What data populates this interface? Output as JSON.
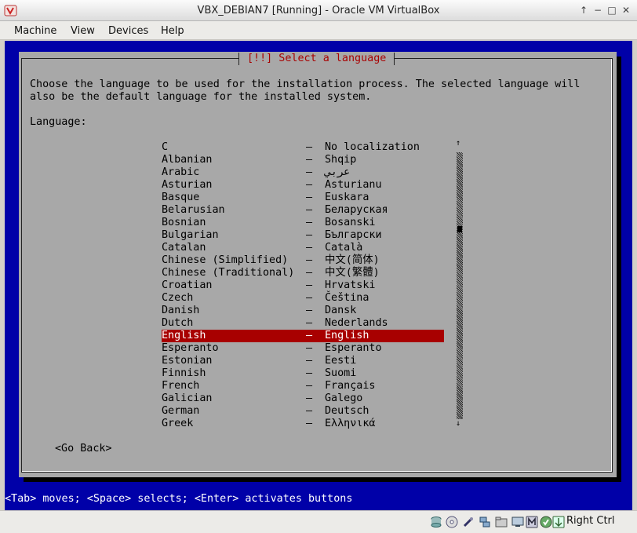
{
  "window": {
    "title": "VBX_DEBIAN7 [Running] - Oracle VM VirtualBox",
    "controls": [
      "up-arrow-icon",
      "minimize-icon",
      "maximize-icon",
      "close-icon"
    ]
  },
  "menubar": {
    "items": [
      {
        "label": "Machine"
      },
      {
        "label": "View"
      },
      {
        "label": "Devices"
      },
      {
        "label": "Help"
      }
    ]
  },
  "installer": {
    "title": "[!!] Select a language",
    "intro": "Choose the language to be used for the installation process. The selected language will\nalso be the default language for the installed system.",
    "language_label": "Language:",
    "languages": [
      {
        "name": "C",
        "native": "No localization"
      },
      {
        "name": "Albanian",
        "native": "Shqip"
      },
      {
        "name": "Arabic",
        "native": "عربي"
      },
      {
        "name": "Asturian",
        "native": "Asturianu"
      },
      {
        "name": "Basque",
        "native": "Euskara"
      },
      {
        "name": "Belarusian",
        "native": "Беларуская"
      },
      {
        "name": "Bosnian",
        "native": "Bosanski"
      },
      {
        "name": "Bulgarian",
        "native": "Български"
      },
      {
        "name": "Catalan",
        "native": "Català"
      },
      {
        "name": "Chinese (Simplified)",
        "native": "中文(简体)"
      },
      {
        "name": "Chinese (Traditional)",
        "native": "中文(繁體)"
      },
      {
        "name": "Croatian",
        "native": "Hrvatski"
      },
      {
        "name": "Czech",
        "native": "Čeština"
      },
      {
        "name": "Danish",
        "native": "Dansk"
      },
      {
        "name": "Dutch",
        "native": "Nederlands"
      },
      {
        "name": "English",
        "native": "English"
      },
      {
        "name": "Esperanto",
        "native": "Esperanto"
      },
      {
        "name": "Estonian",
        "native": "Eesti"
      },
      {
        "name": "Finnish",
        "native": "Suomi"
      },
      {
        "name": "French",
        "native": "Français"
      },
      {
        "name": "Galician",
        "native": "Galego"
      },
      {
        "name": "German",
        "native": "Deutsch"
      },
      {
        "name": "Greek",
        "native": "Ελληνικά"
      }
    ],
    "separator": "–",
    "selected_index": 15,
    "go_back": "<Go Back>",
    "help_line": "<Tab> moves; <Space> selects; <Enter> activates buttons",
    "colors": {
      "background": "#0000a8",
      "dialog": "#a8a8a8",
      "selection": "#a80000",
      "title": "#a80000"
    }
  },
  "statusbar": {
    "icons": [
      "hard-disk-icon",
      "optical-drive-icon",
      "usb-icon",
      "network-icon",
      "shared-folders-icon",
      "display-icon",
      "video-capture-icon",
      "cpu-virtualization-icon",
      "mouse-integration-icon",
      "host-key-icon"
    ],
    "host_key": "Right Ctrl"
  }
}
